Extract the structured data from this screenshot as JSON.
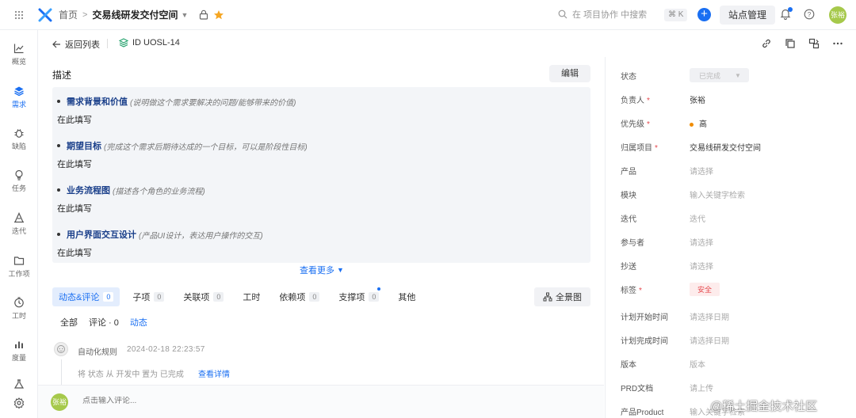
{
  "topbar": {
    "breadcrumb_home": "首页",
    "breadcrumb_project": "交易线研发交付空间",
    "search_placeholder": "在 项目协作 中搜索",
    "shortcut": "⌘ K",
    "plus_label": "+",
    "site_admin": "站点管理",
    "avatar_text": "张裕"
  },
  "sidebar": {
    "items": [
      {
        "label": "概览",
        "icon": "chart-line-icon"
      },
      {
        "label": "需求",
        "icon": "layers-icon"
      },
      {
        "label": "缺陷",
        "icon": "bug-icon"
      },
      {
        "label": "任务",
        "icon": "lightbulb-icon"
      },
      {
        "label": "迭代",
        "icon": "iteration-icon"
      },
      {
        "label": "工作项",
        "icon": "folder-icon"
      },
      {
        "label": "工时",
        "icon": "clock-icon"
      },
      {
        "label": "度量",
        "icon": "bar-chart-icon"
      }
    ]
  },
  "subbar": {
    "back_label": "返回列表",
    "issue_id": "ID UOSL-14"
  },
  "description": {
    "title": "描述",
    "edit_label": "编辑",
    "sections": [
      {
        "name": "需求背景和价值",
        "hint": "(说明做这个需求要解决的问题/能够带来的价值)",
        "fill": "在此填写"
      },
      {
        "name": "期望目标",
        "hint": "(完成这个需求后期待达成的一个目标，可以是阶段性目标)",
        "fill": "在此填写"
      },
      {
        "name": "业务流程图",
        "hint": "(描述各个角色的业务流程)",
        "fill": "在此填写"
      },
      {
        "name": "用户界面交互设计",
        "hint": "(产品UI设计，表达用户操作的交互)",
        "fill": "在此填写"
      }
    ],
    "more_label": "查看更多"
  },
  "tabs": [
    {
      "label": "动态&评论",
      "count": "0"
    },
    {
      "label": "子项",
      "count": "0"
    },
    {
      "label": "关联项",
      "count": "0"
    },
    {
      "label": "工时",
      "count": ""
    },
    {
      "label": "依赖项",
      "count": "0"
    },
    {
      "label": "支撑项",
      "count": "0"
    },
    {
      "label": "其他",
      "count": ""
    }
  ],
  "full_view_label": "全景图",
  "subtabs": {
    "all": "全部",
    "comments": "评论 · 0",
    "activity": "动态"
  },
  "activity": {
    "who": "自动化规则",
    "time": "2024-02-18 22:23:57",
    "text": "将 状态 从 开发中 置为 已完成",
    "link": "查看详情"
  },
  "comment": {
    "avatar_text": "张裕",
    "placeholder": "点击输入评论..."
  },
  "properties": [
    {
      "key": "状态",
      "value": "已完成",
      "required": false,
      "type": "state"
    },
    {
      "key": "负责人",
      "value": "张裕",
      "required": true,
      "type": "dark"
    },
    {
      "key": "优先级",
      "value": "高",
      "required": true,
      "type": "priority"
    },
    {
      "key": "归属项目",
      "value": "交易线研发交付空间",
      "required": true,
      "type": "dark"
    },
    {
      "key": "产品",
      "value": "请选择",
      "required": false,
      "type": "placeholder"
    },
    {
      "key": "模块",
      "value": "输入关键字检索",
      "required": false,
      "type": "placeholder"
    },
    {
      "key": "迭代",
      "value": "迭代",
      "required": false,
      "type": "placeholder"
    },
    {
      "key": "参与者",
      "value": "请选择",
      "required": false,
      "type": "placeholder"
    },
    {
      "key": "抄送",
      "value": "请选择",
      "required": false,
      "type": "placeholder"
    },
    {
      "key": "标签",
      "value": "安全",
      "required": true,
      "type": "tag"
    },
    {
      "key": "计划开始时间",
      "value": "请选择日期",
      "required": false,
      "type": "placeholder"
    },
    {
      "key": "计划完成时间",
      "value": "请选择日期",
      "required": false,
      "type": "placeholder"
    },
    {
      "key": "版本",
      "value": "版本",
      "required": false,
      "type": "placeholder"
    },
    {
      "key": "PRD文档",
      "value": "请上传",
      "required": false,
      "type": "placeholder"
    },
    {
      "key": "产品Product",
      "value": "输入关键字检索",
      "required": false,
      "type": "placeholder"
    }
  ],
  "watermark": "@稀土掘金技术社区",
  "colors": {
    "accent": "#1a6ff2",
    "required": "#e5484d",
    "priority_high": "#f08c00",
    "avatar": "#a6c94b"
  }
}
